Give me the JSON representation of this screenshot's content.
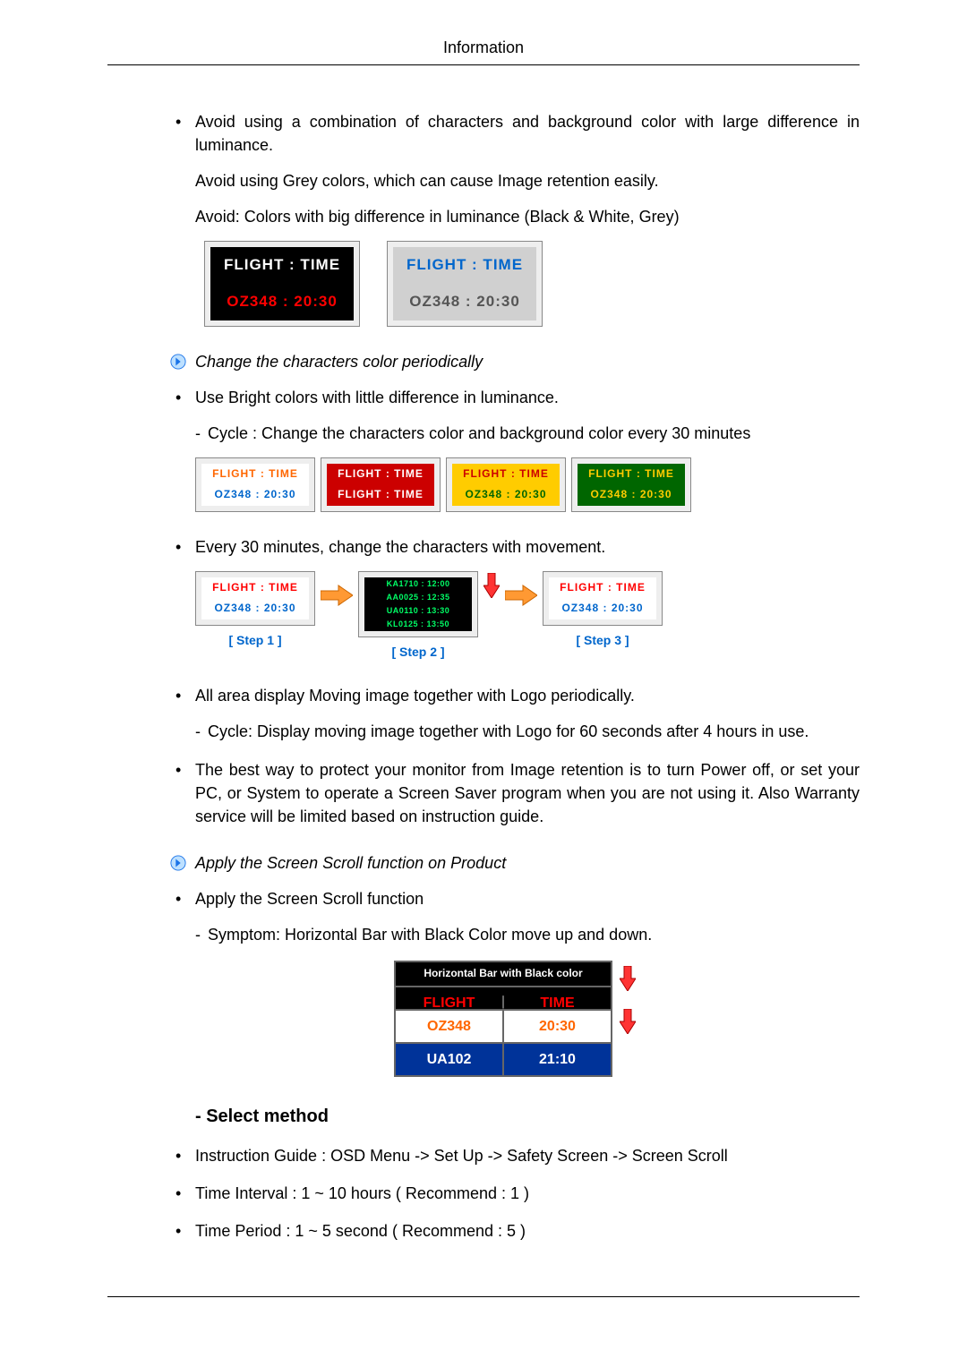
{
  "header": "Information",
  "b1": {
    "p1": "Avoid using a combination of characters and background color with large difference in luminance.",
    "p2": "Avoid using Grey colors, which can cause Image retention easily.",
    "p3": "Avoid: Colors with big difference in luminance (Black & White, Grey)"
  },
  "fig1": {
    "a": {
      "bg1": "#000000",
      "fg1": "#ffffff",
      "l1": "FLIGHT  :  TIME",
      "bg2": "#000000",
      "fg2": "#ff0000",
      "l2": "OZ348    :  20:30"
    },
    "b": {
      "bg1": "#d0d0d0",
      "fg1": "#0066cc",
      "l1": "FLIGHT  :  TIME",
      "bg2": "#d0d0d0",
      "fg2": "#555555",
      "l2": "OZ348    :  20:30"
    }
  },
  "h1": "Change the characters color periodically",
  "b2": "Use Bright colors with little difference in luminance.",
  "b2s1": "Cycle : Change the characters color and background color every 30 minutes",
  "fig2": {
    "a": {
      "bg": "#ffffff",
      "fg1": "#ff6600",
      "fg2": "#0066cc",
      "l1": "FLIGHT  :  TIME",
      "l2": "OZ348    :  20:30"
    },
    "b": {
      "bg": "#cc0000",
      "fg": "#ffffff",
      "l1": "FLIGHT  :  TIME",
      "l2": "FLIGHT  :  TIME"
    },
    "c": {
      "bg": "#ffcc00",
      "fg1": "#cc0000",
      "fg2": "#006600",
      "l1": "FLIGHT  :  TIME",
      "l2": "OZ348   :  20:30"
    },
    "d": {
      "bg": "#006600",
      "fg1": "#ffcc00",
      "fg2": "#ffcc00",
      "l1": "FLIGHT  :  TIME",
      "l2": "OZ348   :  20:30"
    }
  },
  "b3": "Every 30 minutes, change the characters with movement.",
  "fig3": {
    "a": {
      "bg": "#ffffff",
      "fg1": "#ff0000",
      "fg2": "#0066cc",
      "l1": "FLIGHT  :  TIME",
      "l2": "OZ348   : 20:30",
      "step": "[ Step 1 ]"
    },
    "b": {
      "bg": "#000000",
      "fg": "#00ff66",
      "l1": "KA1710 : 12:00",
      "l2": "AA0025 : 12:35",
      "l3": "UA0110 : 13:30",
      "l4": "KL0125 : 13:50",
      "step": "[ Step 2 ]"
    },
    "c": {
      "bg": "#ffffff",
      "fg1": "#ff0000",
      "fg2": "#0066cc",
      "l1": "FLIGHT  :  TIME",
      "l2": "OZ348   :  20:30",
      "step": "[ Step 3 ]"
    }
  },
  "b4": {
    "p1": "All area display Moving image together with Logo periodically.",
    "s1": "Cycle: Display moving image together with Logo for 60 seconds after 4 hours in use."
  },
  "b5": "The best way to protect your monitor from Image retention is to turn Power off, or set your PC, or System to operate a Screen Saver program when you are not using it. Also Warranty service will be limited based on instruction guide.",
  "h2": "Apply the Screen Scroll function on Product",
  "b6": "Apply the Screen Scroll function",
  "b6s1": "Symptom: Horizontal Bar with Black Color move up and down.",
  "fig4": {
    "title": "Horizontal Bar with Black color",
    "r1": {
      "bg": "#000000",
      "fg": "#ff0000",
      "c1": "FLIGHT",
      "c2": "TIME"
    },
    "r2": {
      "bg": "#ffffff",
      "fg": "#ff6600",
      "c1": "OZ348",
      "c2": "20:30"
    },
    "r3": {
      "bg": "#003399",
      "fg": "#ffffff",
      "c1": "UA102",
      "c2": "21:10"
    }
  },
  "sec1": "Select method",
  "m1": "Instruction Guide : OSD Menu -> Set Up -> Safety Screen -> Screen Scroll",
  "m2": "Time Interval : 1 ~ 10 hours ( Recommend : 1 )",
  "m3": "Time Period : 1 ~ 5 second ( Recommend : 5 )"
}
